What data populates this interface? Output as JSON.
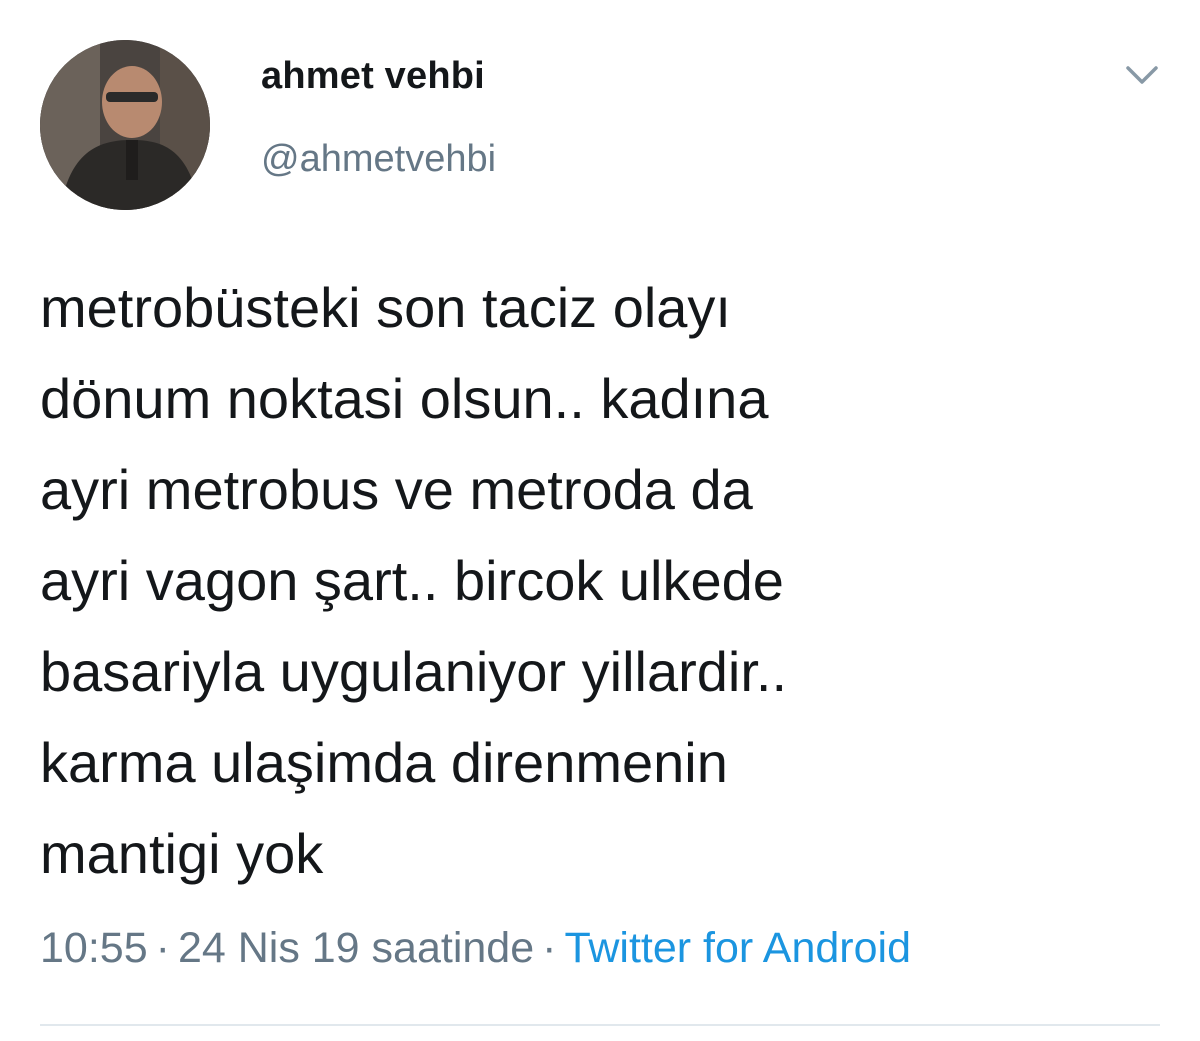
{
  "user": {
    "display_name": "ahmet vehbi",
    "handle": "@ahmetvehbi",
    "avatar_icon": "profile-photo"
  },
  "tweet": {
    "text": "metrobüsteki son taciz olayı\ndönum noktasi olsun.. kadına\nayri metrobus ve metroda da\nayri vagon şart.. bircok ulkede\nbasariyla uygulaniyor yillardir..\nkarma ulaşimda direnmenin\nmantigi yok",
    "time": "10:55",
    "date": "24 Nis 19 saatinde",
    "separator": "·",
    "source": "Twitter for Android"
  },
  "menu": {
    "icon": "chevron-down-icon"
  },
  "colors": {
    "text": "#14171a",
    "secondary": "#657786",
    "link": "#1b95e0",
    "divider": "#e1e8ed"
  }
}
